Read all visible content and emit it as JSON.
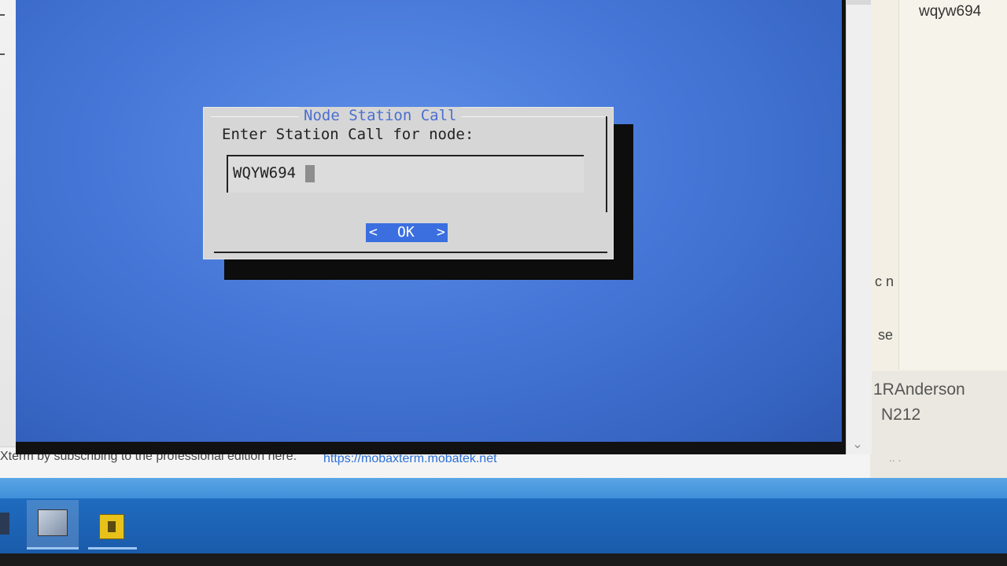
{
  "dialog": {
    "title": "Node Station Call",
    "prompt": "Enter Station Call for node:",
    "input_value": "WQYW694",
    "ok_left": "<",
    "ok_label": "OK",
    "ok_right": ">"
  },
  "statusbar": {
    "text": "Xterm by subscribing to the professional edition here:",
    "link": "https://mobaxterm.mobatek.net"
  },
  "background_app": {
    "username": "wqyw694",
    "fragment_1": "c n",
    "fragment_2": "se",
    "name": "1RAnderson",
    "room": "N212",
    "dots": ".. ."
  },
  "icons": {
    "scroll_down": "⌄"
  },
  "colors": {
    "terminal_blue": "#4677d8",
    "dialog_gray": "#d6d6d6",
    "title_blue": "#4a6fd0",
    "button_blue": "#3b6fe0",
    "link_blue": "#2b6fd6",
    "taskbar_blue": "#1f6bbf"
  }
}
